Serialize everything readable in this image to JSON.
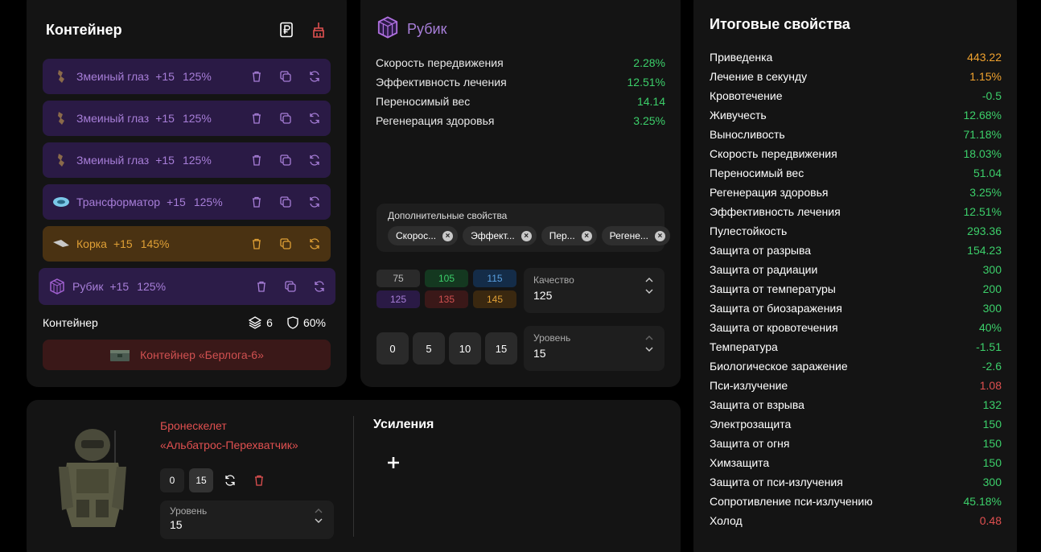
{
  "container": {
    "title": "Контейнер",
    "artifacts": [
      {
        "name": "Змеиный глаз",
        "level": "+15",
        "pct": "125%",
        "tier": "purple"
      },
      {
        "name": "Змеиный глаз",
        "level": "+15",
        "pct": "125%",
        "tier": "purple"
      },
      {
        "name": "Змеиный глаз",
        "level": "+15",
        "pct": "125%",
        "tier": "purple"
      },
      {
        "name": "Трансформатор",
        "level": "+15",
        "pct": "125%",
        "tier": "purple"
      },
      {
        "name": "Корка",
        "level": "+15",
        "pct": "145%",
        "tier": "gold"
      },
      {
        "name": "Рубик",
        "level": "+15",
        "pct": "125%",
        "tier": "purple"
      }
    ],
    "footer_label": "Контейнер",
    "slots": "6",
    "protection": "60%",
    "container_name": "Контейнер «Берлога-6»"
  },
  "artifact": {
    "name": "Рубик",
    "properties": [
      {
        "label": "Скорость передвижения",
        "value": "2.28%"
      },
      {
        "label": "Эффективность лечения",
        "value": "12.51%"
      },
      {
        "label": "Переносимый вес",
        "value": "14.14"
      },
      {
        "label": "Регенерация здоровья",
        "value": "3.25%"
      }
    ],
    "extra_label": "Дополнительные свойства",
    "extra_chips": [
      "Скорос...",
      "Эффект...",
      "Пер...",
      "Регене..."
    ],
    "quality_grid": [
      "75",
      "105",
      "115",
      "125",
      "135",
      "145"
    ],
    "quality_label": "Качество",
    "quality_value": "125",
    "level_buttons": [
      "0",
      "5",
      "10",
      "15"
    ],
    "level_label": "Уровень",
    "level_value": "15"
  },
  "totals": {
    "title": "Итоговые свойства",
    "rows": [
      {
        "label": "Приведенка",
        "value": "443.22",
        "color": "orange"
      },
      {
        "label": "Лечение в секунду",
        "value": "1.15%",
        "color": "orange"
      },
      {
        "label": "Кровотечение",
        "value": "-0.5",
        "color": "green"
      },
      {
        "label": "Живучесть",
        "value": "12.68%",
        "color": "green"
      },
      {
        "label": "Выносливость",
        "value": "71.18%",
        "color": "green"
      },
      {
        "label": "Скорость передвижения",
        "value": "18.03%",
        "color": "green"
      },
      {
        "label": "Переносимый вес",
        "value": "51.04",
        "color": "green"
      },
      {
        "label": "Регенерация здоровья",
        "value": "3.25%",
        "color": "green"
      },
      {
        "label": "Эффективность лечения",
        "value": "12.51%",
        "color": "green"
      },
      {
        "label": "Пулестойкость",
        "value": "293.36",
        "color": "green"
      },
      {
        "label": "Защита от разрыва",
        "value": "154.23",
        "color": "green"
      },
      {
        "label": "Защита от радиации",
        "value": "300",
        "color": "green"
      },
      {
        "label": "Защита от температуры",
        "value": "200",
        "color": "green"
      },
      {
        "label": "Защита от биозаражения",
        "value": "300",
        "color": "green"
      },
      {
        "label": "Защита от кровотечения",
        "value": "40%",
        "color": "green"
      },
      {
        "label": "Температура",
        "value": "-1.51",
        "color": "green"
      },
      {
        "label": "Биологическое заражение",
        "value": "-2.6",
        "color": "green"
      },
      {
        "label": "Пси-излучение",
        "value": "1.08",
        "color": "red"
      },
      {
        "label": "Защита от взрыва",
        "value": "132",
        "color": "green"
      },
      {
        "label": "Электрозащита",
        "value": "150",
        "color": "green"
      },
      {
        "label": "Защита от огня",
        "value": "150",
        "color": "green"
      },
      {
        "label": "Химзащита",
        "value": "150",
        "color": "green"
      },
      {
        "label": "Защита от пси-излучения",
        "value": "300",
        "color": "green"
      },
      {
        "label": "Сопротивление пси-излучению",
        "value": "45.18%",
        "color": "green"
      },
      {
        "label": "Холод",
        "value": "0.48",
        "color": "red"
      }
    ]
  },
  "armor": {
    "name_line1": "Бронескелет",
    "name_line2": "«Альбатрос-Перехватчик»",
    "btn_min": "0",
    "btn_max": "15",
    "level_label": "Уровень",
    "level_value": "15",
    "boost_title": "Усиления"
  }
}
